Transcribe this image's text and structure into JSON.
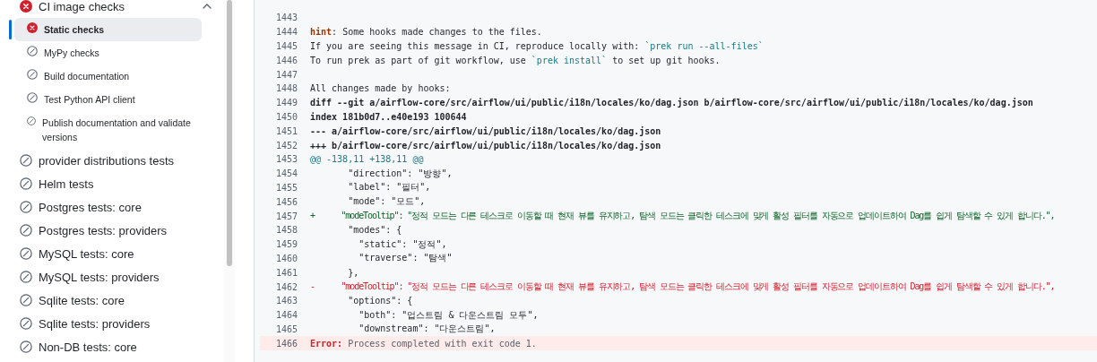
{
  "sidebar": {
    "items": [
      {
        "label": "CI image checks",
        "failed": true,
        "expanded": true,
        "children": [
          {
            "label": "Static checks",
            "failed": true,
            "selected": true
          },
          {
            "label": "MyPy checks",
            "failed": false,
            "selected": false
          },
          {
            "label": "Build documentation",
            "failed": false,
            "selected": false
          },
          {
            "label": "Test Python API client",
            "failed": false,
            "selected": false
          },
          {
            "label": "Publish documentation and validate versions",
            "failed": false,
            "selected": false
          }
        ]
      },
      {
        "label": "provider distributions tests",
        "failed": false
      },
      {
        "label": "Helm tests",
        "failed": false
      },
      {
        "label": "Postgres tests: core",
        "failed": false
      },
      {
        "label": "Postgres tests: providers",
        "failed": false
      },
      {
        "label": "MySQL tests: core",
        "failed": false
      },
      {
        "label": "MySQL tests: providers",
        "failed": false
      },
      {
        "label": "Sqlite tests: core",
        "failed": false
      },
      {
        "label": "Sqlite tests: providers",
        "failed": false
      },
      {
        "label": "Non-DB tests: core",
        "failed": false
      }
    ]
  },
  "log": {
    "lines": [
      {
        "number": "1443",
        "kind": "plain"
      },
      {
        "number": "1444",
        "kind": "plain",
        "segments": [
          {
            "kind": "label",
            "text": "hint"
          },
          {
            "kind": "text",
            "text": ": Some hooks made changes to the files."
          }
        ]
      },
      {
        "number": "1445",
        "kind": "plain",
        "segments": [
          {
            "kind": "text",
            "text": "If you are seeing this message in CI, reproduce locally with: "
          },
          {
            "kind": "code",
            "text": "`prek run --all-files`"
          }
        ]
      },
      {
        "number": "1446",
        "kind": "plain",
        "segments": [
          {
            "kind": "text",
            "text": "To run prek as part of git workflow, use "
          },
          {
            "kind": "code",
            "text": "`prek install`"
          },
          {
            "kind": "text",
            "text": " to set up git hooks."
          }
        ]
      },
      {
        "number": "1447",
        "kind": "plain"
      },
      {
        "number": "1448",
        "kind": "plain",
        "segments": [
          {
            "kind": "text",
            "text": "All changes made by hooks:"
          }
        ]
      },
      {
        "number": "1449",
        "kind": "header",
        "segments": [
          {
            "kind": "text",
            "text": "diff --git a/airflow-core/src/airflow/ui/public/i18n/locales/ko/dag.json b/airflow-core/src/airflow/ui/public/i18n/locales/ko/dag.json"
          }
        ]
      },
      {
        "number": "1450",
        "kind": "header",
        "segments": [
          {
            "kind": "text",
            "text": "index 181b0d7..e40e193 100644"
          }
        ]
      },
      {
        "number": "1451",
        "kind": "header",
        "segments": [
          {
            "kind": "text",
            "text": "--- a/airflow-core/src/airflow/ui/public/i18n/locales/ko/dag.json"
          }
        ]
      },
      {
        "number": "1452",
        "kind": "header",
        "segments": [
          {
            "kind": "text",
            "text": "+++ b/airflow-core/src/airflow/ui/public/i18n/locales/ko/dag.json"
          }
        ]
      },
      {
        "number": "1453",
        "kind": "hunk",
        "segments": [
          {
            "kind": "text",
            "text": "@@ -138,11 +138,11 @@"
          }
        ]
      },
      {
        "number": "1454",
        "kind": "plain",
        "segments": [
          {
            "kind": "text",
            "text": "       \"direction\": \"방향\","
          }
        ]
      },
      {
        "number": "1455",
        "kind": "plain",
        "segments": [
          {
            "kind": "text",
            "text": "       \"label\": \"필터\","
          }
        ]
      },
      {
        "number": "1456",
        "kind": "plain",
        "segments": [
          {
            "kind": "text",
            "text": "       \"mode\": \"모드\","
          }
        ]
      },
      {
        "number": "1457",
        "kind": "added",
        "segments": [
          {
            "kind": "text",
            "text": "+      \"modeTooltip\": \"정적 모드는 다른 테스크로 이동할 때 현재 뷰를 유지하고, 탐색 모드는 클릭한 테스크에 맞게 활성 필터를 자동으로 업데이트하여 Dag를 쉽게 탐색할 수 있게 합니다.\","
          }
        ]
      },
      {
        "number": "1458",
        "kind": "plain",
        "segments": [
          {
            "kind": "text",
            "text": "       \"modes\": {"
          }
        ]
      },
      {
        "number": "1459",
        "kind": "plain",
        "segments": [
          {
            "kind": "text",
            "text": "         \"static\": \"정적\","
          }
        ]
      },
      {
        "number": "1460",
        "kind": "plain",
        "segments": [
          {
            "kind": "text",
            "text": "         \"traverse\": \"탐색\""
          }
        ]
      },
      {
        "number": "1461",
        "kind": "plain",
        "segments": [
          {
            "kind": "text",
            "text": "       },"
          }
        ]
      },
      {
        "number": "1462",
        "kind": "removed",
        "segments": [
          {
            "kind": "text",
            "text": "-      \"modeTooltip\": \"정적 모드는 다른 테스크로 이동할 때 현재 뷰를 유지하고, 탐색 모드는 클릭한 테스크에 맞게 활성 필터를 자동으로 업데이트하여 Dag를 쉽게 탐색할 수 있게 합니다.\","
          }
        ]
      },
      {
        "number": "1463",
        "kind": "plain",
        "segments": [
          {
            "kind": "text",
            "text": "       \"options\": {"
          }
        ]
      },
      {
        "number": "1464",
        "kind": "plain",
        "segments": [
          {
            "kind": "text",
            "text": "         \"both\": \"업스트림 & 다운스트림 모두\","
          }
        ]
      },
      {
        "number": "1465",
        "kind": "plain",
        "segments": [
          {
            "kind": "text",
            "text": "         \"downstream\": \"다운스트림\","
          }
        ]
      },
      {
        "number": "1466",
        "kind": "error",
        "segments": [
          {
            "kind": "error",
            "text": "Error:"
          },
          {
            "kind": "muted",
            "text": " Process completed with exit code 1."
          }
        ]
      }
    ]
  }
}
